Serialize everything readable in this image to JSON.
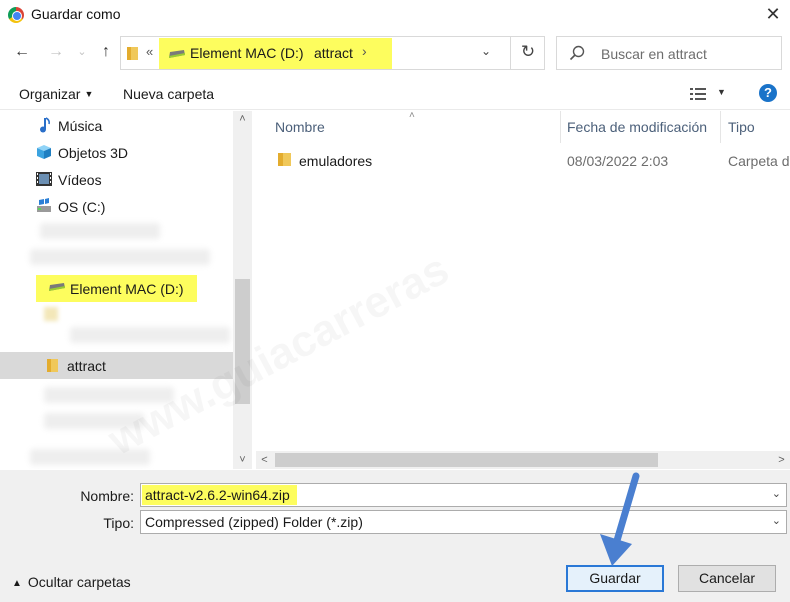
{
  "window": {
    "title": "Guardar como",
    "close_glyph": "✕",
    "app_icon": "chrome-icon"
  },
  "nav": {
    "back_glyph": "←",
    "forward_glyph": "→",
    "up_glyph": "↑",
    "recent_glyph": "⌄"
  },
  "address": {
    "overflow_glyph": "«",
    "crumbs": [
      "Element MAC (D:)",
      "attract"
    ],
    "separator": "›",
    "dropdown_glyph": "⌄",
    "refresh_glyph": "↻"
  },
  "search": {
    "placeholder": "Buscar en attract"
  },
  "command_bar": {
    "organize_label": "Organizar",
    "organize_caret": "▼",
    "new_folder_label": "Nueva carpeta",
    "view_caret": "▼",
    "help_label": "?"
  },
  "nav_pane": {
    "items": [
      {
        "label": "Música",
        "icon": "music-icon"
      },
      {
        "label": "Objetos 3D",
        "icon": "objects-3d-icon"
      },
      {
        "label": "Vídeos",
        "icon": "videos-icon"
      },
      {
        "label": "OS (C:)",
        "icon": "drive-icon"
      },
      {
        "label": "Element MAC (D:)",
        "icon": "drive-icon"
      },
      {
        "label": "attract",
        "icon": "folder-icon"
      }
    ],
    "scroll_up": "˄",
    "scroll_down": "˅"
  },
  "file_list": {
    "columns": [
      "Nombre",
      "Fecha de modificación",
      "Tipo"
    ],
    "sort_glyph": "˄",
    "rows": [
      {
        "name": "emuladores",
        "modified": "08/03/2022 2:03",
        "type": "Carpeta de"
      }
    ],
    "scroll_left": "<",
    "scroll_right": ">"
  },
  "form": {
    "name_label": "Nombre:",
    "name_value": "attract-v2.6.2-win64.zip",
    "type_label": "Tipo:",
    "type_value": "Compressed (zipped) Folder (*.zip)",
    "caret": "⌄"
  },
  "footer": {
    "hide_folders_caret": "▲",
    "hide_folders_label": "Ocultar carpetas",
    "save_label": "Guardar",
    "cancel_label": "Cancelar"
  },
  "colors": {
    "highlight": "#fdfd5e",
    "accent_blue": "#2a78d6",
    "annotation_arrow": "#4a7fd0"
  }
}
